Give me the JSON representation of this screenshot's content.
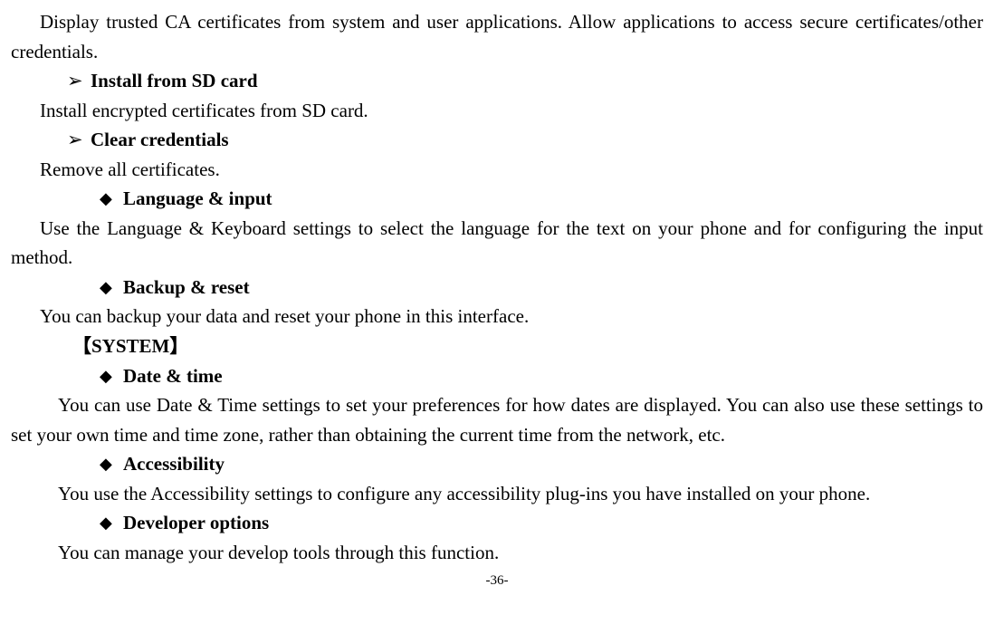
{
  "p1": "Display trusted CA certificates from system and user applications. Allow applications to access secure certificates/other credentials.",
  "arrow1_label": "Install from SD card",
  "arrow1_desc": "Install encrypted certificates from SD card.",
  "arrow2_label": "Clear credentials",
  "arrow2_desc": "Remove all certificates.",
  "diamond1_label": "Language & input",
  "diamond1_desc": "Use the Language & Keyboard settings to select the language for the text on your phone and for configuring the input method.",
  "diamond2_label": "Backup & reset",
  "diamond2_desc": "You can backup your data and reset your phone in this interface.",
  "system_label": "【SYSTEM】",
  "diamond3_label": "Date & time",
  "diamond3_desc": "You can use Date & Time settings to set your preferences for how dates are displayed. You can also use these settings to set your own time and time zone, rather than obtaining the current time from the network, etc.",
  "diamond4_label": "Accessibility",
  "diamond4_desc": "You use the Accessibility settings to configure any accessibility plug-ins you have installed on your phone.",
  "diamond5_label": "Developer options",
  "diamond5_desc": "You can manage your develop tools through this function.",
  "page_number": "-36-"
}
